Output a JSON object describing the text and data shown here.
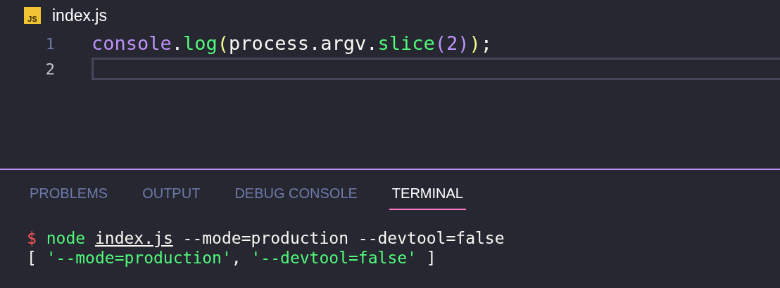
{
  "editor_tab": {
    "icon_text": "JS",
    "title": "index.js"
  },
  "code_lines": [
    {
      "number": "1",
      "current": false,
      "tokens": [
        {
          "kind": "object",
          "text": "console"
        },
        {
          "kind": "plain",
          "text": "."
        },
        {
          "kind": "method",
          "text": "log"
        },
        {
          "kind": "bracket1",
          "text": "("
        },
        {
          "kind": "plain",
          "text": "process.argv."
        },
        {
          "kind": "method",
          "text": "slice"
        },
        {
          "kind": "bracket2",
          "text": "("
        },
        {
          "kind": "number",
          "text": "2"
        },
        {
          "kind": "bracket2",
          "text": ")"
        },
        {
          "kind": "bracket1",
          "text": ")"
        },
        {
          "kind": "plain",
          "text": ";"
        }
      ]
    },
    {
      "number": "2",
      "current": true
    }
  ],
  "panel_tabs": [
    {
      "label": "PROBLEMS",
      "selected": false
    },
    {
      "label": "OUTPUT",
      "selected": false
    },
    {
      "label": "DEBUG CONSOLE",
      "selected": false
    },
    {
      "label": "TERMINAL",
      "selected": true
    }
  ],
  "terminal_lines": [
    {
      "tokens": [
        {
          "kind": "prompt",
          "text": "$ "
        },
        {
          "kind": "command",
          "text": "node "
        },
        {
          "kind": "link",
          "text": "index.js"
        },
        {
          "kind": "plain",
          "text": " --mode=production --devtool=false"
        }
      ]
    },
    {
      "tokens": [
        {
          "kind": "plain",
          "text": "[ "
        },
        {
          "kind": "string",
          "text": "'--mode=production'"
        },
        {
          "kind": "plain",
          "text": ", "
        },
        {
          "kind": "string",
          "text": "'--devtool=false'"
        },
        {
          "kind": "plain",
          "text": " ]"
        }
      ]
    }
  ]
}
